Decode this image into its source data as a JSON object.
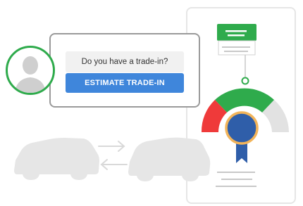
{
  "trade_in": {
    "question": "Do you have a trade-in?",
    "cta_label": "ESTIMATE TRADE-IN"
  },
  "icons": {
    "avatar": "user-silhouette-icon",
    "car_left": "car-icon",
    "car_right": "car-icon",
    "swap": "swap-arrows-icon",
    "badge": "award-ribbon-icon",
    "gauge": "value-gauge-icon"
  },
  "colors": {
    "accent_blue": "#3f86db",
    "green": "#2fab4c",
    "red": "#ef3a3a",
    "medal_blue": "#2f5ea9",
    "medal_ring": "#f2b45a",
    "gray": "#e0e0e0"
  }
}
